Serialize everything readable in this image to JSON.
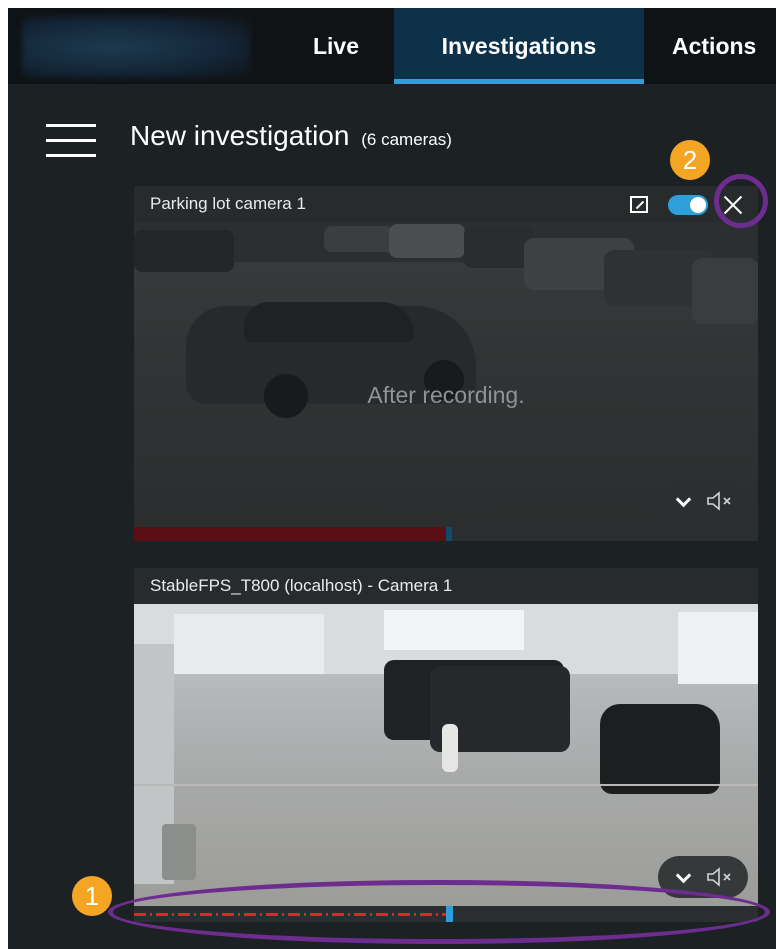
{
  "nav": {
    "tabs": [
      {
        "label": "Live",
        "active": false
      },
      {
        "label": "Investigations",
        "active": true
      },
      {
        "label": "Actions",
        "active": false
      }
    ]
  },
  "header": {
    "title": "New investigation",
    "camera_count": "(6 cameras)"
  },
  "cameras": [
    {
      "name": "Parking lot camera 1",
      "overlay_message": "After recording.",
      "live_toggle_on": true,
      "timeline_progress": 0.5
    },
    {
      "name": "StableFPS_T800 (localhost) - Camera 1",
      "timeline_progress": 0.5
    }
  ],
  "callouts": {
    "timeline_callout": "1",
    "close_callout": "2"
  },
  "colors": {
    "accent": "#2e9fd8",
    "active_tab_bg": "#0c3148",
    "callout": "#f5a524",
    "highlight_ring": "#6d2d8f",
    "recording": "#e0262b"
  }
}
